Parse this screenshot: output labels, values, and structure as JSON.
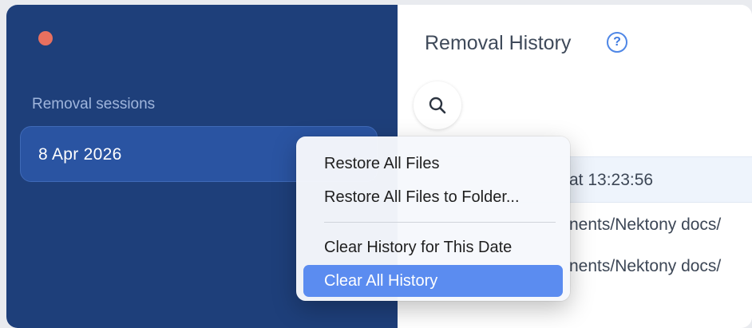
{
  "sidebar": {
    "section_label": "Removal sessions",
    "sessions": [
      {
        "label": "8 Apr 2026",
        "selected": true
      }
    ]
  },
  "main": {
    "title": "Removal History",
    "help_icon": "?",
    "search_icon": "search-icon",
    "list_header": "at 13:23:56",
    "rows": [
      "nents/Nektony docs/",
      "nents/Nektony docs/"
    ]
  },
  "context_menu": {
    "items": [
      {
        "label": "Restore All Files"
      },
      {
        "label": "Restore All Files to Folder..."
      },
      {
        "label": "Clear History for This Date"
      },
      {
        "label": "Clear All History",
        "highlighted": true
      }
    ]
  },
  "colors": {
    "sidebar_bg": "#1e3f7a",
    "session_bg": "#2a54a2",
    "close_button": "#e8705f",
    "menu_highlight": "#5b8cf0",
    "accent": "#3f7ae0"
  }
}
